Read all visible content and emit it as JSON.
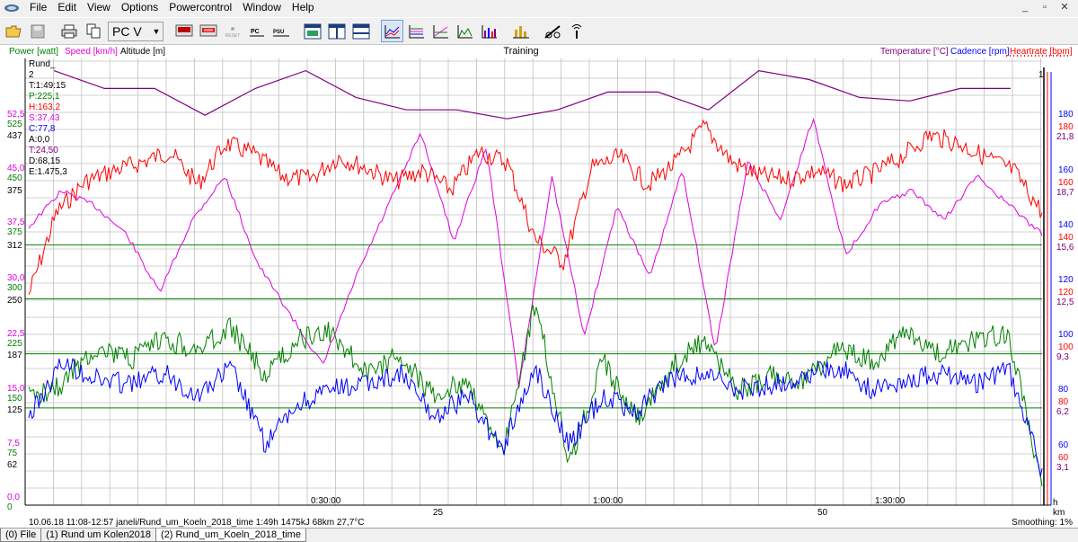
{
  "menu": [
    "File",
    "Edit",
    "View",
    "Options",
    "Powercontrol",
    "Window",
    "Help"
  ],
  "window_controls": [
    "_",
    "▫",
    "✕"
  ],
  "toolbar": {
    "combo_value": "PC V",
    "reset_label": "RESET",
    "pc_label": "PC",
    "psu_label": "PSU"
  },
  "header": {
    "power": "Power [watt]",
    "speed": "Speed [km/h]",
    "altitude": "Altitude [m]",
    "title": "Training",
    "temperature": "Temperature [°C]",
    "cadence": "Cadence [rpm]",
    "heartrate": "Heartrate [bpm]"
  },
  "colors": {
    "power": "#008000",
    "speed": "#e000e0",
    "altitude": "#000000",
    "temperature": "#800080",
    "cadence": "#0000ff",
    "heartrate": "#ff0000",
    "grid": "#c0c0c0",
    "threshold": "#008000"
  },
  "info": {
    "lap_label": "Rund_",
    "lap_number": "2",
    "time": "T:1:49:15",
    "power": "P:225,1",
    "heartrate": "H:163,2",
    "speed": "S:37,43",
    "cadence": "C:77,8",
    "altitude": "A:0,0",
    "temperature": "T:24,50",
    "distance": "D:68,15",
    "energy": "E:1.475,3"
  },
  "cursor_label": "1",
  "footer": {
    "status": "10.06.18 11:08-12:57 janeli/Rund_um_Koeln_2018_time 1:49h 1475kJ 68km 27,7°C",
    "smoothing": "Smoothing: 1%",
    "unit_km": "km",
    "unit_h": "h"
  },
  "tabs": [
    "(0) File",
    "(1) Rund um Kolen2018",
    "(2) Rund_um_Koeln_2018_time"
  ],
  "chart_data": {
    "type": "line",
    "title": "Training",
    "x_time_ticks": [
      "0:30:00",
      "1:00:00",
      "1:30:00"
    ],
    "x_km_ticks": [
      "25",
      "50"
    ],
    "left_axes": {
      "speed": [
        "52,5",
        "45,0",
        "37,5",
        "30,0",
        "22,5",
        "15,0",
        "7,5",
        "0,0"
      ],
      "power_a": [
        "525",
        "450",
        "375",
        "300",
        "225",
        "150",
        "75",
        "0"
      ],
      "power_b": [
        "437",
        "375",
        "312",
        "250",
        "187",
        "125",
        "62"
      ]
    },
    "right_axes": {
      "cadence": [
        "180",
        "160",
        "140",
        "120",
        "100",
        "80",
        "60"
      ],
      "heartrate": [
        "180",
        "160",
        "140",
        "120",
        "100",
        "80",
        "60"
      ],
      "temperature": [
        "21,8",
        "18,7",
        "15,6",
        "12,5",
        "9,3",
        "6,2",
        "3,1"
      ]
    },
    "threshold_lines": [
      "312",
      "250",
      "187",
      "125"
    ],
    "series": [
      {
        "name": "Heartrate [bpm]",
        "approx_range": [
          60,
          180
        ],
        "sampled": [
          120,
          150,
          161,
          165,
          168,
          172,
          160,
          175,
          171,
          163,
          162,
          170,
          166,
          161,
          165,
          158,
          172,
          168,
          140,
          132,
          166,
          170,
          160,
          168,
          181,
          168,
          163,
          162,
          165,
          160,
          164,
          170,
          178,
          175,
          170,
          165,
          150
        ]
      },
      {
        "name": "Speed [km/h]",
        "approx_range": [
          0,
          52.5
        ],
        "sampled": [
          37,
          42,
          40,
          36,
          28,
          38,
          44,
          32,
          25,
          18,
          30,
          40,
          50,
          35,
          48,
          15,
          44,
          22,
          40,
          30,
          45,
          20,
          46,
          38,
          52,
          33,
          40,
          42,
          38,
          44,
          40,
          36
        ]
      },
      {
        "name": "Power [watt]",
        "approx_range": [
          0,
          525
        ],
        "sampled": [
          150,
          170,
          220,
          200,
          230,
          215,
          245,
          180,
          230,
          240,
          180,
          210,
          150,
          175,
          70,
          280,
          60,
          200,
          120,
          190,
          230,
          160,
          180,
          170,
          220,
          200,
          240,
          210,
          230,
          240,
          30
        ]
      },
      {
        "name": "Cadence [rpm]",
        "approx_range": [
          60,
          100
        ],
        "sampled": [
          70,
          90,
          84,
          82,
          86,
          78,
          88,
          60,
          75,
          80,
          82,
          86,
          70,
          78,
          58,
          88,
          60,
          78,
          72,
          84,
          86,
          80,
          82,
          85,
          88,
          80,
          84,
          86,
          82,
          88,
          50
        ]
      },
      {
        "name": "Temperature [°C]",
        "approx_range": [
          15.6,
          21.8
        ],
        "sampled": [
          25.5,
          24.5,
          24.5,
          23,
          24.5,
          25.5,
          24,
          23.3,
          23.3,
          22.8,
          23.3,
          24.3,
          24.3,
          23.3,
          25.5,
          25,
          24,
          23.8,
          24.5,
          24.5
        ]
      }
    ]
  }
}
